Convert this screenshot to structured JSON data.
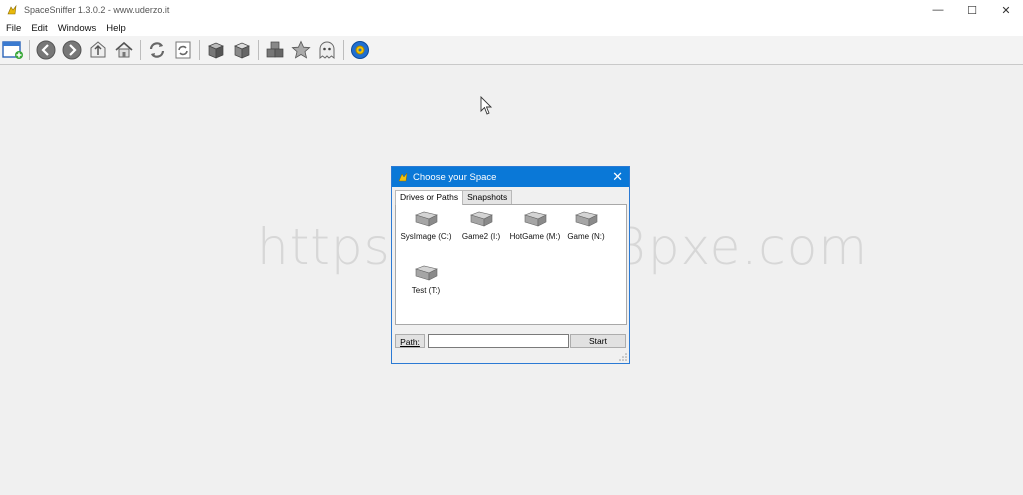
{
  "window": {
    "title": "SpaceSniffer 1.3.0.2 - www.uderzo.it",
    "controls": {
      "minimize": "—",
      "maximize": "☐",
      "close": "✕"
    }
  },
  "menu": [
    "File",
    "Edit",
    "Windows",
    "Help"
  ],
  "toolbar": {
    "buttons": [
      "new-window-icon",
      "back-icon",
      "forward-icon",
      "up-icon",
      "home-icon",
      "refresh-icon",
      "refresh-page-icon",
      "box-closed-icon",
      "box-open-icon",
      "boxes-icon",
      "star-icon",
      "ghost-icon",
      "gear-icon"
    ]
  },
  "watermark": "https://www.58pxe.com",
  "dialog": {
    "title": "Choose your Space",
    "close": "✕",
    "tabs": [
      "Drives or Paths",
      "Snapshots"
    ],
    "drives": [
      {
        "label": "SysImage (C:)"
      },
      {
        "label": "Game2 (I:)"
      },
      {
        "label": "HotGame (M:)"
      },
      {
        "label": "Game (N:)"
      },
      {
        "label": "Test (T:)"
      }
    ],
    "path_label": "Path:",
    "path_value": "",
    "start_label": "Start"
  },
  "colors": {
    "accent": "#0a78d7",
    "background": "#f0f0f0"
  }
}
